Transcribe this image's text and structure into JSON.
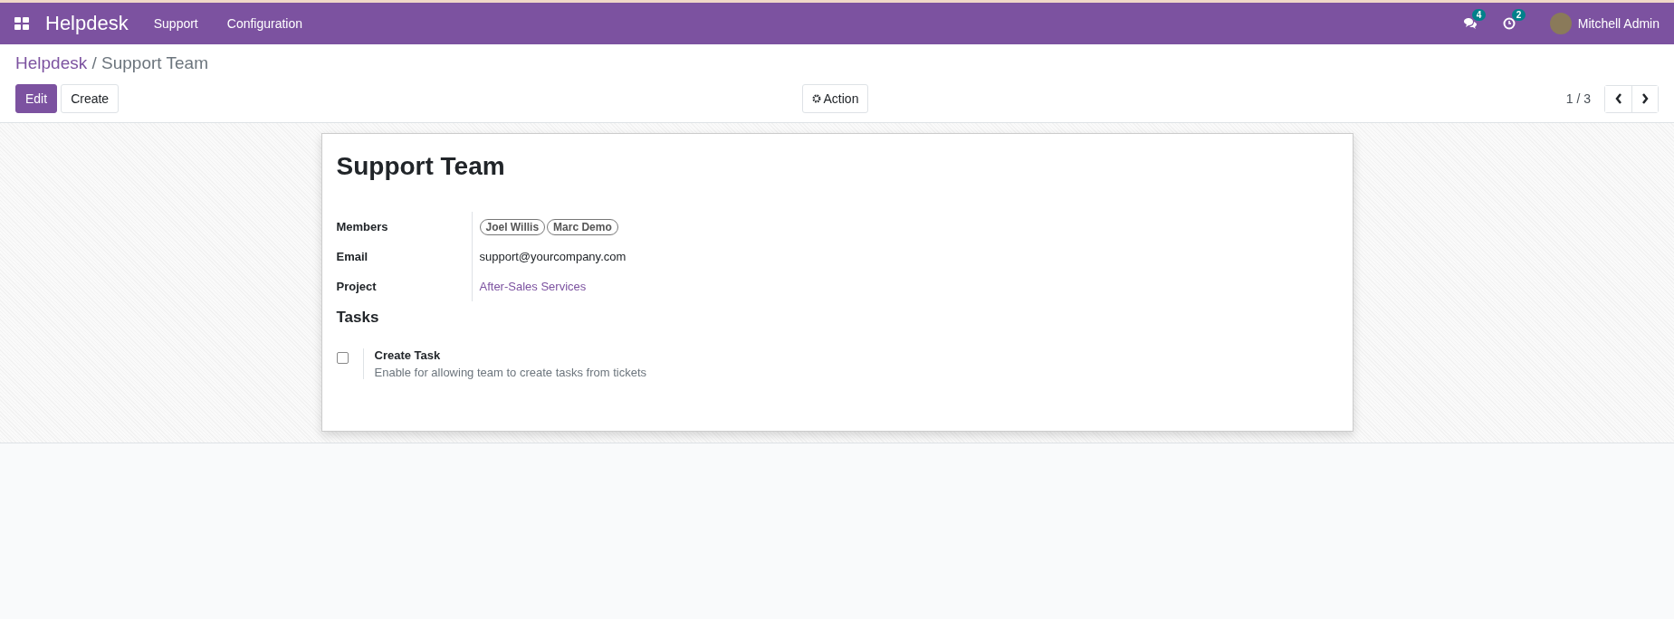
{
  "navbar": {
    "app": "Helpdesk",
    "menus": [
      "Support",
      "Configuration"
    ],
    "messages_count": "4",
    "activities_count": "2",
    "user": "Mitchell Admin"
  },
  "breadcrumb": {
    "parent": "Helpdesk",
    "separator": "/",
    "current": "Support Team"
  },
  "buttons": [
    {
      "label": "Edit",
      "kind": "primary"
    },
    {
      "label": "Create",
      "kind": "secondary"
    }
  ],
  "action": {
    "label": "Action"
  },
  "pager": {
    "value": "1 / 3"
  },
  "form": {
    "title": "Support Team",
    "fields": [
      {
        "label": "Members",
        "kind": "tags",
        "tags": [
          "Joel Willis",
          "Marc Demo"
        ]
      },
      {
        "label": "Email",
        "kind": "text",
        "value": "support@yourcompany.com"
      },
      {
        "label": "Project",
        "kind": "link",
        "value": "After-Sales Services"
      }
    ],
    "section": "Tasks",
    "settings": [
      {
        "label": "Create Task",
        "description": "Enable for allowing team to create tasks from tickets",
        "checked": false
      }
    ]
  }
}
